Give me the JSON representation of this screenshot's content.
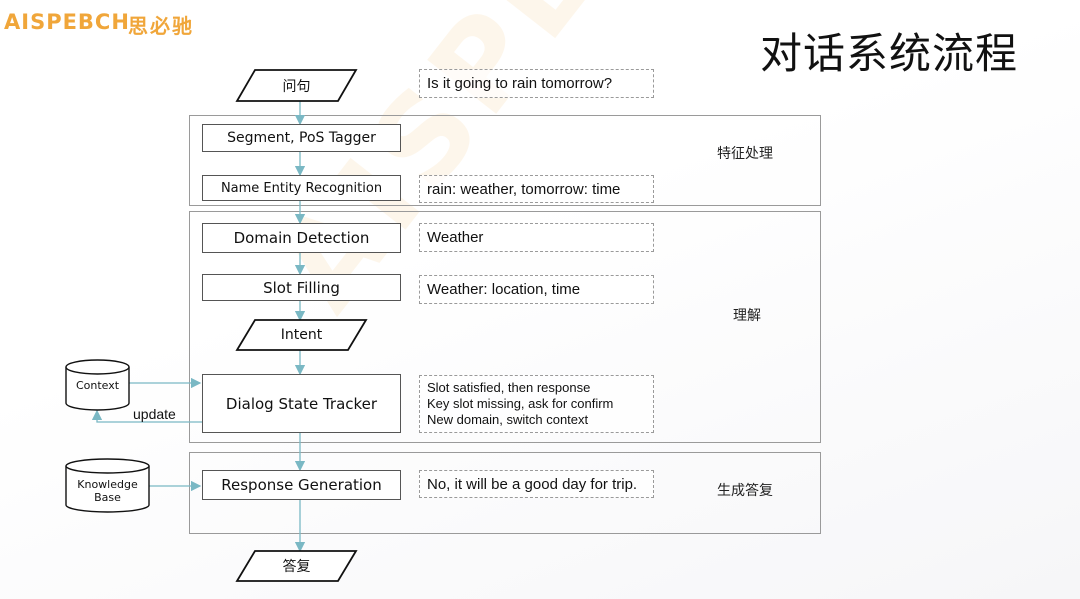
{
  "logo": {
    "text_en": "AISPEBCH",
    "text_cn": "思必驰"
  },
  "title": "对话系统流程",
  "sections": {
    "feature": "特征处理",
    "understanding": "理解",
    "generation": "生成答复"
  },
  "nodes": {
    "question": "问句",
    "segment": "Segment, PoS Tagger",
    "ner": "Name Entity Recognition",
    "domain": "Domain Detection",
    "slot": "Slot Filling",
    "intent": "Intent",
    "dst": "Dialog State Tracker",
    "response": "Response Generation",
    "answer": "答复",
    "context": "Context",
    "kb_line1": "Knowledge",
    "kb_line2": "Base",
    "update": "update"
  },
  "notes": {
    "question": "Is it going to rain tomorrow?",
    "ner": "rain: weather, tomorrow: time",
    "domain": "Weather",
    "slot": "Weather: location, time",
    "dst_1": "Slot satisfied, then response",
    "dst_2": "Key slot missing, ask for confirm",
    "dst_3": "New domain, switch context",
    "response": "No, it will be a good day for trip."
  },
  "colors": {
    "arrow": "#7ab8c4",
    "logo": "#f0a63a"
  }
}
